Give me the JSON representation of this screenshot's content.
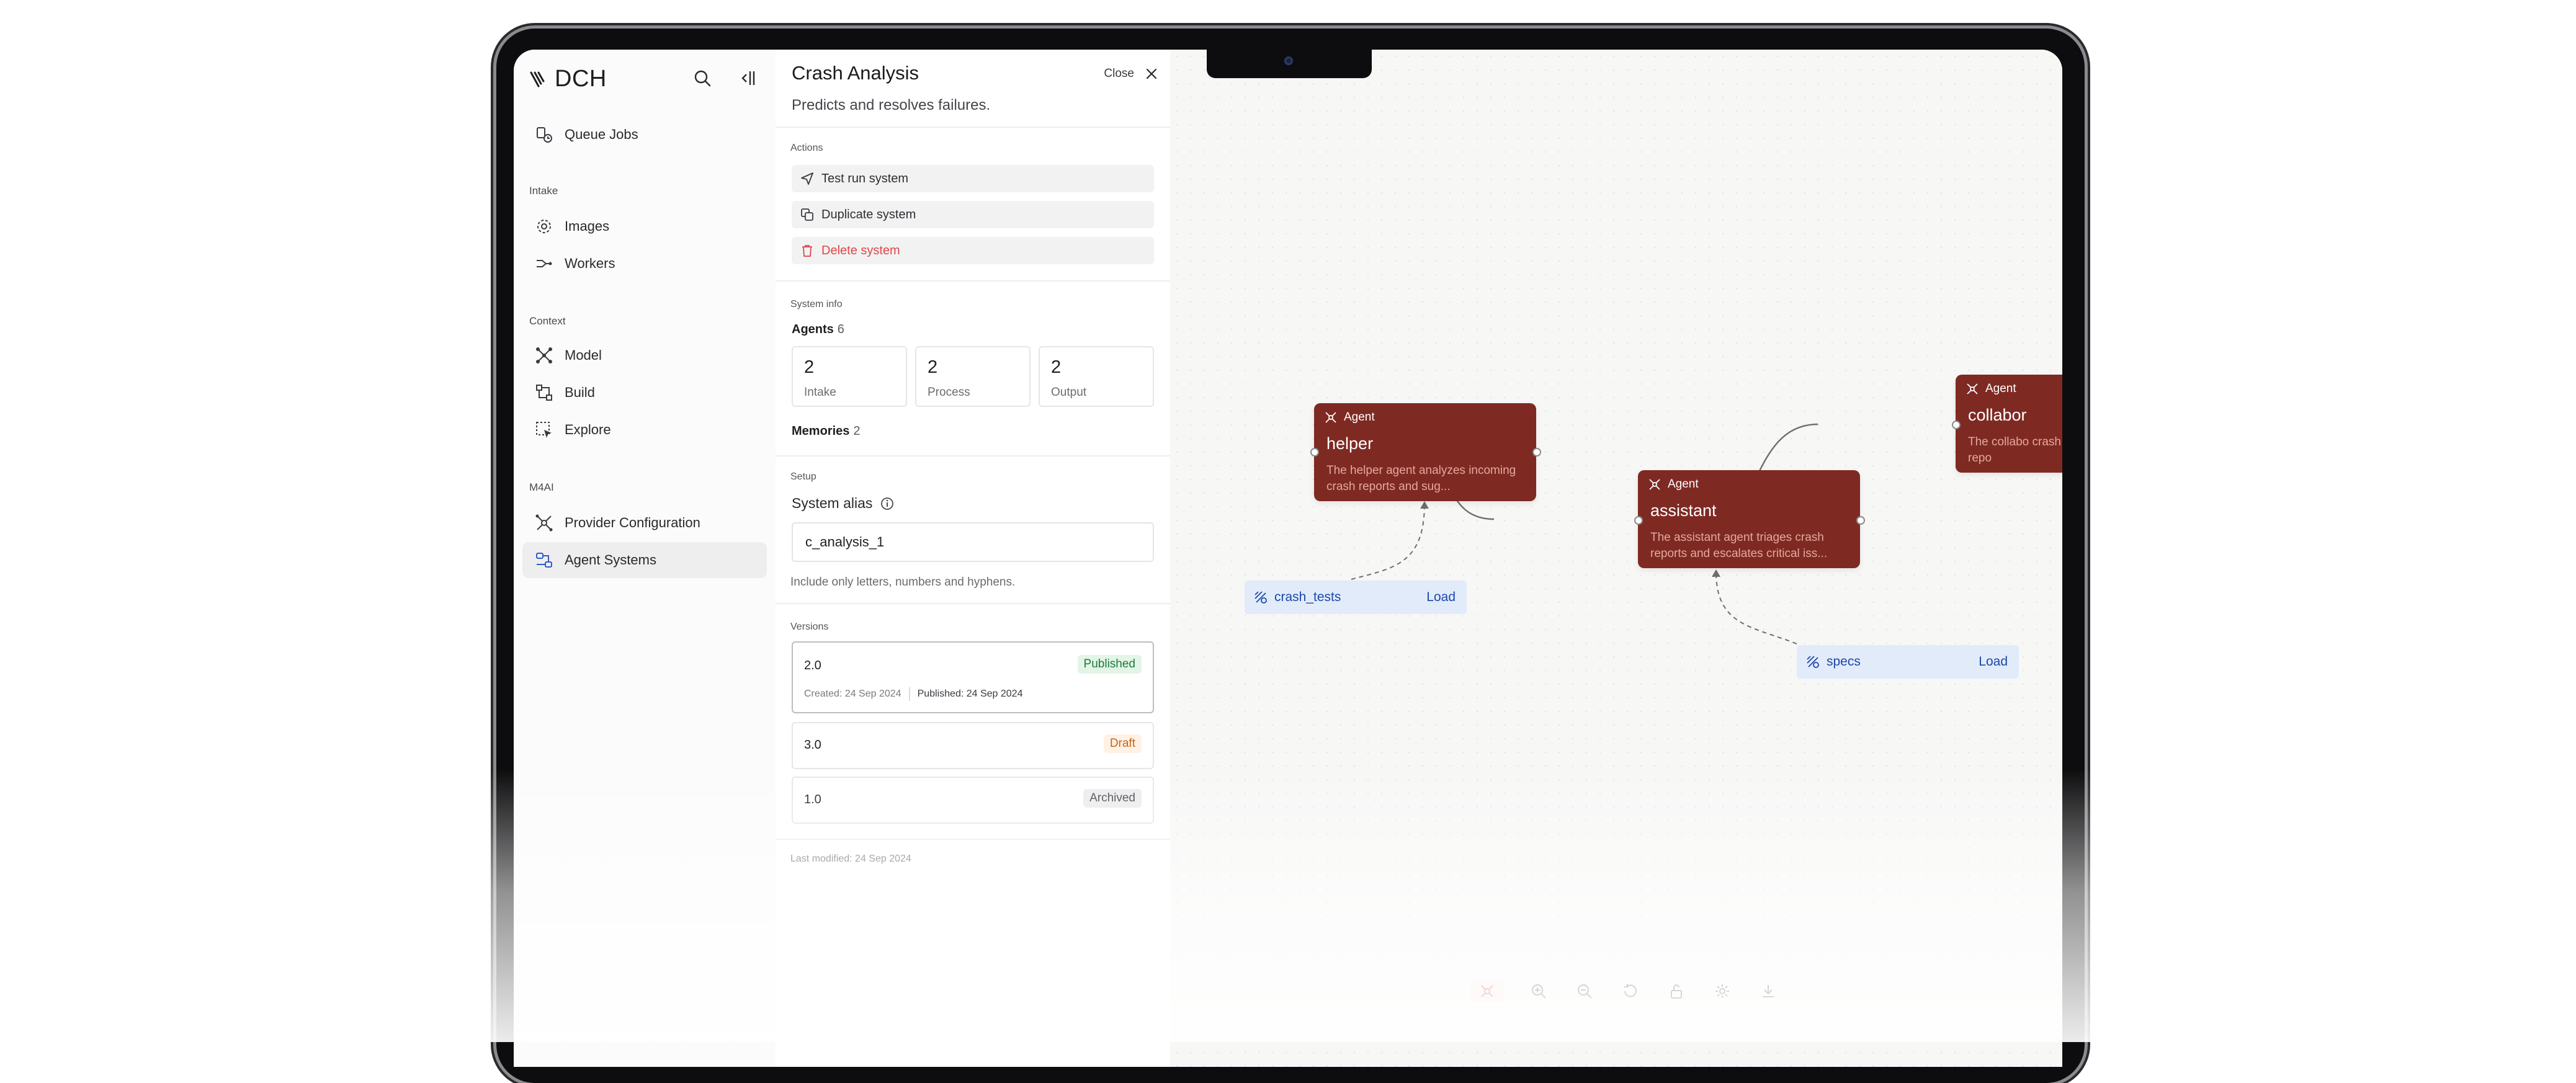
{
  "sidebar": {
    "logo": "DCH",
    "items": [
      {
        "label": "Queue Jobs",
        "icon": "queue-jobs-icon"
      },
      {
        "label": "Images",
        "icon": "images-icon"
      },
      {
        "label": "Workers",
        "icon": "workers-icon"
      },
      {
        "label": "Model",
        "icon": "model-icon"
      },
      {
        "label": "Build",
        "icon": "build-icon"
      },
      {
        "label": "Explore",
        "icon": "explore-icon"
      },
      {
        "label": "Provider Configuration",
        "icon": "provider-configuration-icon"
      },
      {
        "label": "Agent Systems",
        "icon": "agent-systems-icon",
        "active": true
      }
    ],
    "sections": {
      "intake": "Intake",
      "context": "Context",
      "m4ai": "M4AI"
    }
  },
  "panel": {
    "title": "Crash Analysis",
    "subtitle": "Predicts and resolves failures.",
    "close_label": "Close",
    "actions_label": "Actions",
    "actions": [
      {
        "label": "Test run system",
        "icon": "send-icon"
      },
      {
        "label": "Duplicate system",
        "icon": "duplicate-icon"
      },
      {
        "label": "Delete system",
        "icon": "trash-icon"
      }
    ],
    "info_label": "System info",
    "agents_label": "Agents",
    "agents_count": "6",
    "stats": [
      {
        "value": "2",
        "label": "Intake"
      },
      {
        "value": "2",
        "label": "Process"
      },
      {
        "value": "2",
        "label": "Output"
      }
    ],
    "memories_label": "Memories",
    "memories_count": "2",
    "setup_label": "Setup",
    "alias_label": "System alias",
    "alias_value": "c_analysis_1",
    "alias_hint": "Include only letters, numbers and hyphens.",
    "versions_label": "Versions",
    "versions": [
      {
        "number": "2.0",
        "status": "Published",
        "created": "Created: 24 Sep 2024",
        "published": "Published: 24 Sep 2024"
      },
      {
        "number": "3.0",
        "status": "Draft"
      },
      {
        "number": "1.0",
        "status": "Archived"
      }
    ],
    "last_modified": "Last modified: 24 Sep 2024"
  },
  "canvas": {
    "agents": [
      {
        "tag": "Agent",
        "name": "helper",
        "description": "The helper agent analyzes incoming crash reports and sug..."
      },
      {
        "tag": "Agent",
        "name": "assistant",
        "description": "The assistant agent triages crash reports and escalates critical iss..."
      },
      {
        "tag": "Agent",
        "name": "collabor",
        "description": "The collabo crash repo"
      }
    ],
    "memories": [
      {
        "name": "crash_tests",
        "action": "Load"
      },
      {
        "name": "specs",
        "action": "Load"
      }
    ]
  },
  "colors": {
    "agent": "#7e2a23",
    "memory_bg": "#e1ebfa",
    "memory_text": "#1d48a8",
    "danger": "#e04545"
  }
}
